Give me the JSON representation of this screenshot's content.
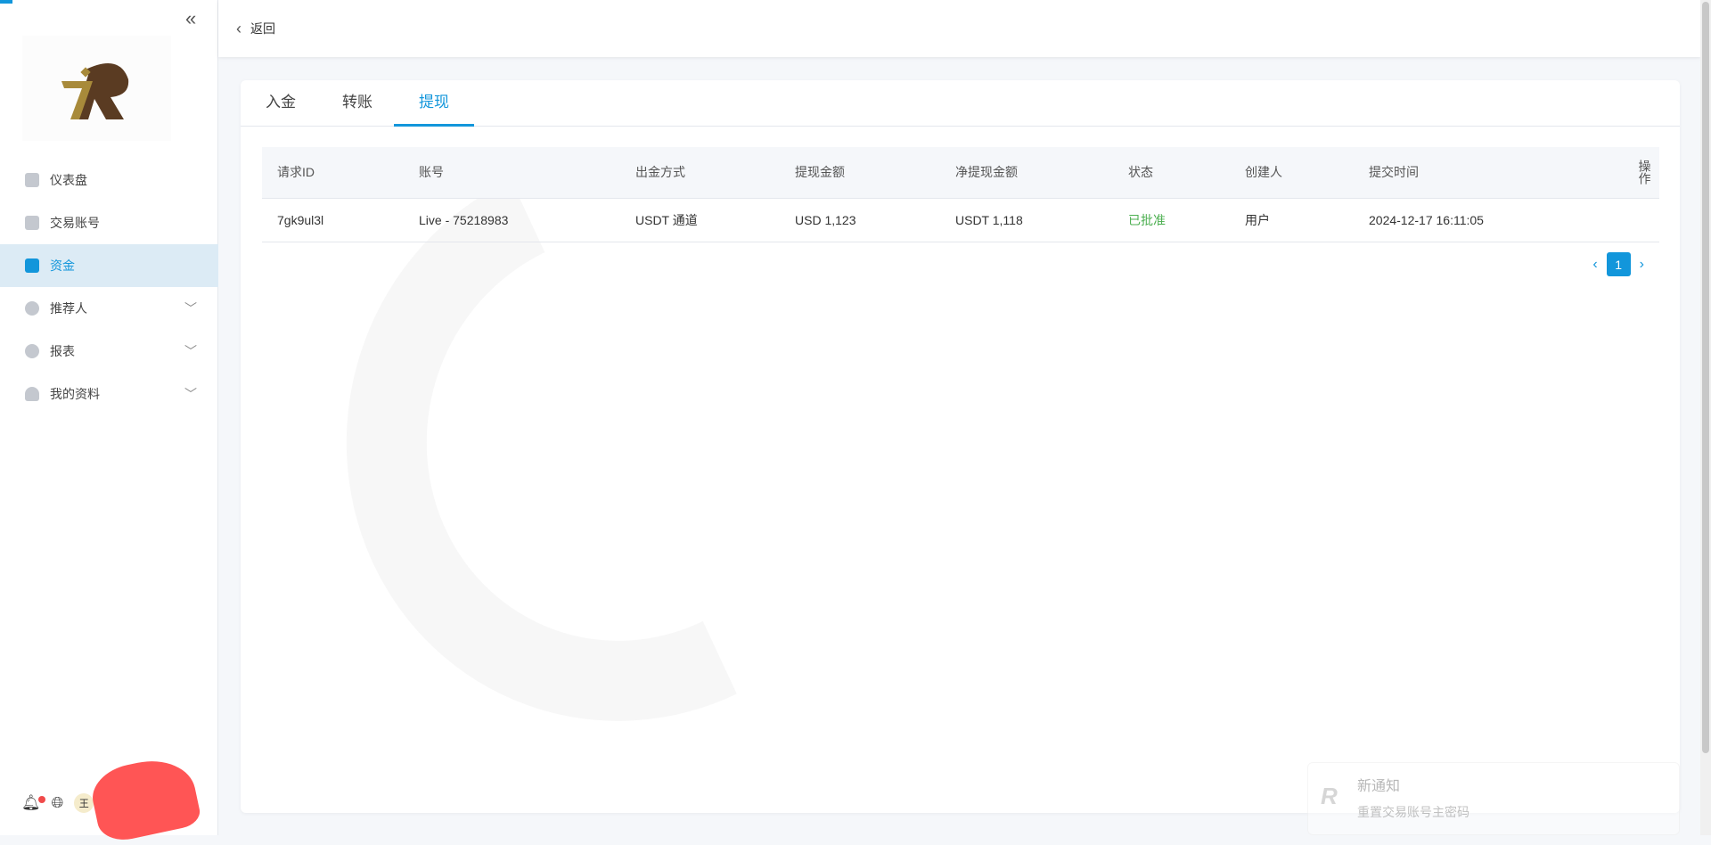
{
  "sidebar": {
    "items": [
      {
        "label": "仪表盘",
        "icon": "dashboard-icon"
      },
      {
        "label": "交易账号",
        "icon": "trading-account-icon"
      },
      {
        "label": "资金",
        "icon": "wallet-icon",
        "active": true
      },
      {
        "label": "推荐人",
        "icon": "referrer-icon",
        "expandable": true
      },
      {
        "label": "报表",
        "icon": "report-icon",
        "expandable": true
      },
      {
        "label": "我的资料",
        "icon": "profile-icon",
        "expandable": true
      }
    ],
    "avatar_initial": "王"
  },
  "header": {
    "back_label": "返回"
  },
  "tabs": [
    "入金",
    "转账",
    "提现"
  ],
  "table": {
    "headers": [
      "请求ID",
      "账号",
      "出金方式",
      "提现金额",
      "净提现金额",
      "状态",
      "创建人",
      "提交时间",
      "操作"
    ],
    "rows": [
      [
        "7gk9ul3l",
        "Live - 75218983",
        "USDT 通道",
        "USD 1,123",
        "USDT 1,118",
        "已批准",
        "用户",
        "2024-12-17 16:11:05",
        ""
      ]
    ]
  },
  "pagination": {
    "current": "1"
  },
  "notification": {
    "title": "新通知",
    "body": "重置交易账号主密码"
  },
  "colors": {
    "accent": "#1296db",
    "approved": "#4caf50"
  }
}
